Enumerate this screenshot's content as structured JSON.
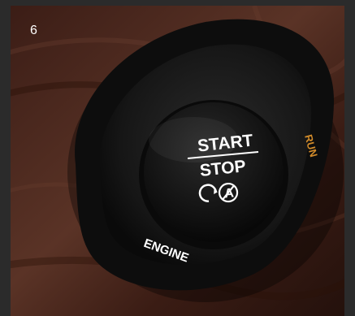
{
  "page_number": "6",
  "button": {
    "line1": "START",
    "line2": "STOP",
    "bezel_label": "ENGINE",
    "side_label": "RUN",
    "icon": "auto-start-stop-off-icon"
  },
  "colors": {
    "wood_dark": "#2a1510",
    "wood_mid": "#4a2a20",
    "bezel": "#1a1a1a",
    "button_face": "#121212",
    "side_label": "#d08a2a",
    "text": "#ffffff"
  }
}
